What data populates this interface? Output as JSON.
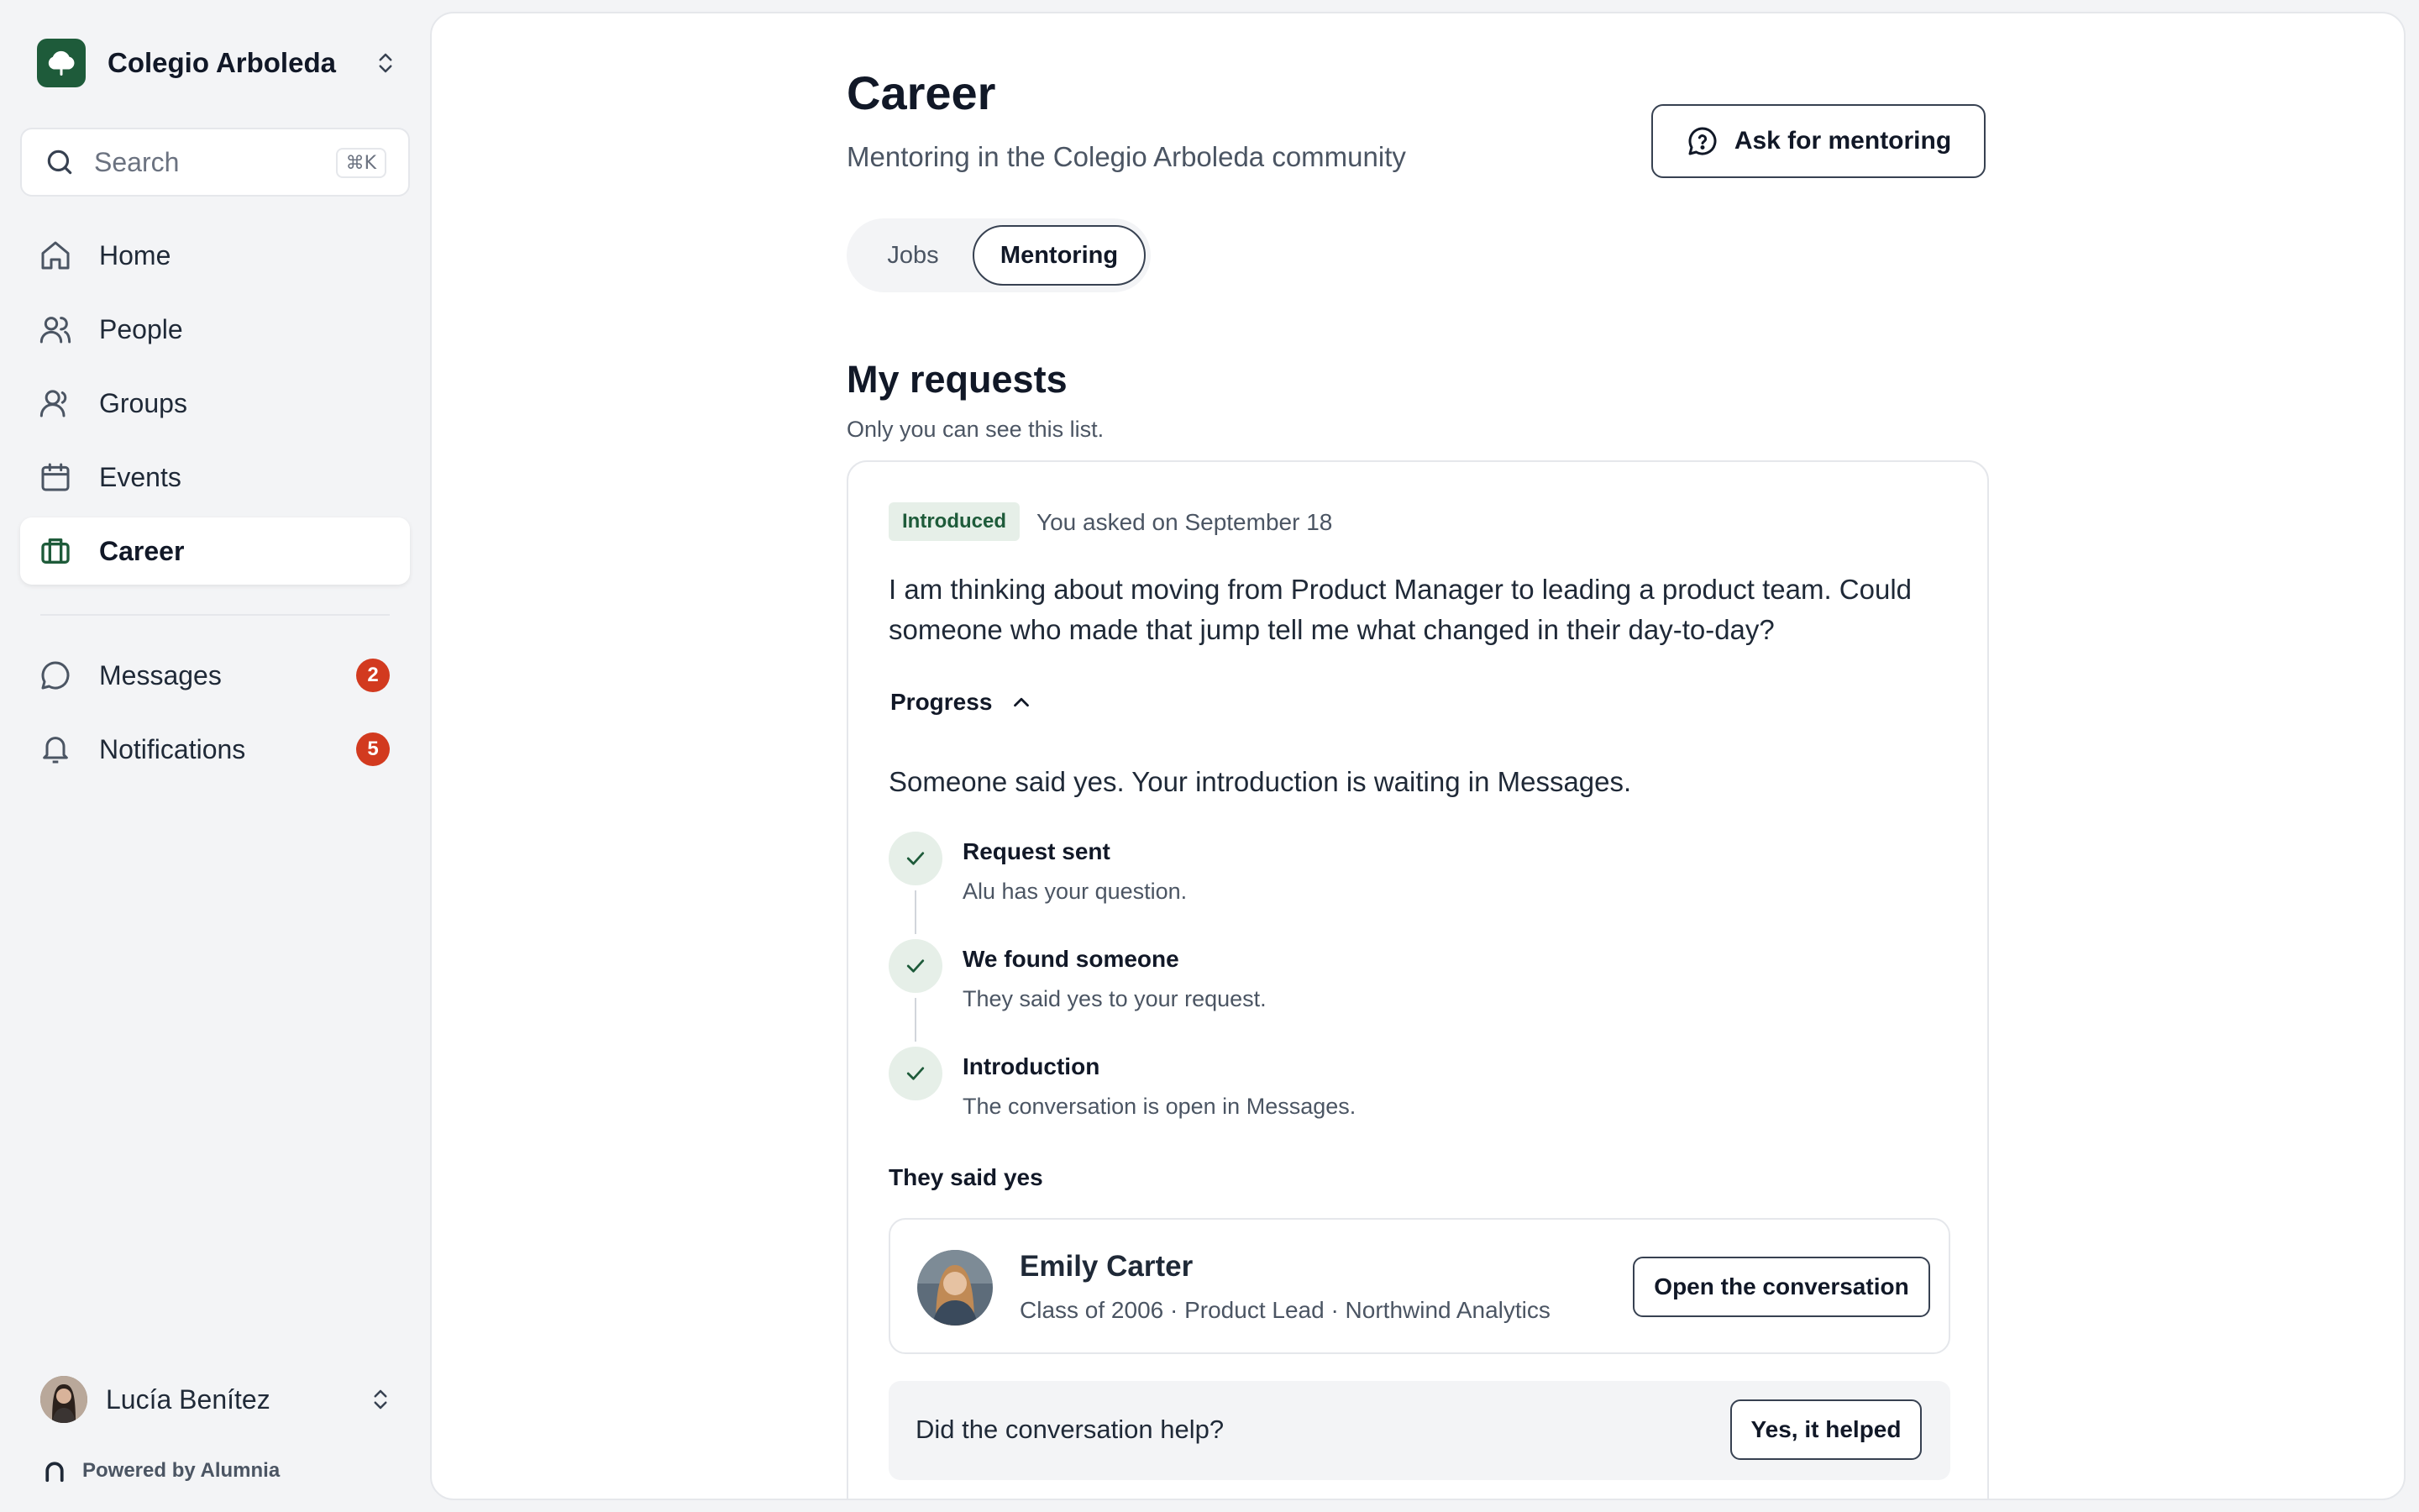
{
  "sidebar": {
    "org_name": "Colegio Arboleda",
    "search": {
      "placeholder": "Search",
      "shortcut": "⌘K"
    },
    "nav": [
      {
        "label": "Home",
        "icon": "home-icon"
      },
      {
        "label": "People",
        "icon": "people-icon"
      },
      {
        "label": "Groups",
        "icon": "groups-icon"
      },
      {
        "label": "Events",
        "icon": "calendar-icon"
      },
      {
        "label": "Career",
        "icon": "briefcase-icon",
        "active": true
      }
    ],
    "nav_secondary": [
      {
        "label": "Messages",
        "icon": "chat-icon",
        "badge": "2"
      },
      {
        "label": "Notifications",
        "icon": "bell-icon",
        "badge": "5"
      }
    ],
    "user_name": "Lucía Benítez",
    "powered_by": "Powered by Alumnia"
  },
  "header": {
    "title": "Career",
    "subtitle": "Mentoring in the Colegio Arboleda community",
    "ask_button": "Ask for mentoring"
  },
  "tabs": [
    {
      "label": "Jobs",
      "selected": false
    },
    {
      "label": "Mentoring",
      "selected": true
    }
  ],
  "requests": {
    "title": "My requests",
    "subtitle": "Only you can see this list.",
    "items": [
      {
        "status": "Introduced",
        "asked": "You asked on September 18",
        "question": "I am thinking about moving from Product Manager to leading a product team. Could someone who made that jump tell me what changed in their day-to-day?",
        "progress_label": "Progress",
        "progress_message": "Someone said yes. Your introduction is waiting in Messages.",
        "steps": [
          {
            "title": "Request sent",
            "desc": "Alu has your question."
          },
          {
            "title": "We found someone",
            "desc": "They said yes to your request."
          },
          {
            "title": "Introduction",
            "desc": "The conversation is open in Messages."
          }
        ],
        "said_yes_label": "They said yes",
        "mentor": {
          "name": "Emily Carter",
          "meta": "Class of 2006 · Product Lead · Northwind Analytics",
          "open_button": "Open the conversation"
        },
        "feedback": {
          "question": "Did the conversation help?",
          "button": "Yes, it helped"
        }
      }
    ]
  },
  "colors": {
    "brand": "#1e5b3a",
    "badge_red": "#d23a1f",
    "status_bg": "#e6efe8"
  }
}
